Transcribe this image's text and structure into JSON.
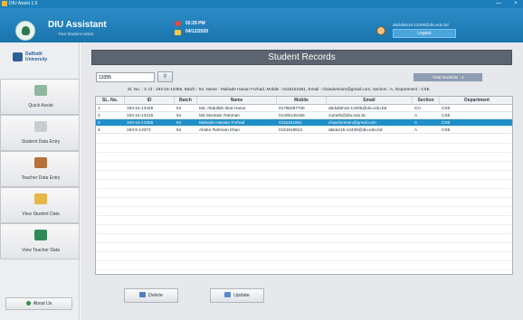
{
  "window": {
    "title": "DIU Assist 1.5",
    "minimize": "—",
    "close": "×"
  },
  "header": {
    "app_name": "DIU Assistant",
    "app_subtitle": "Your Student Assist",
    "time": "02:29 PM",
    "date": "04/12/2020",
    "user_email": "abdullah15-13406@diu.edu.bd",
    "logout_label": "Logout"
  },
  "sidebar": {
    "brand": "Daffodil University",
    "items": [
      {
        "label": "Quick Assist",
        "icon": "book-icon"
      },
      {
        "label": "Student Data Entry",
        "icon": "student-icon"
      },
      {
        "label": "Teacher Data Entry",
        "icon": "teacher-icon"
      },
      {
        "label": "View Student Data",
        "icon": "view-student-icon"
      },
      {
        "label": "View Teacher Data",
        "icon": "view-teacher-icon"
      }
    ],
    "about_label": "About Us"
  },
  "main": {
    "banner": "Student Records",
    "search_value": "13355",
    "total_label": "Total Students : 4",
    "info": "Sl. No. : 3, Id : 193-15-13355, Batch : 54, Name : Mahade Hasan Forhad, Mobile : 0115161651, Email : chandumiam@gmail.com, Section : A, Department : CSE",
    "columns": [
      "SL. No.",
      "ID",
      "Batch",
      "Name",
      "Mobile",
      "Email",
      "Section",
      "Department"
    ],
    "rows": [
      [
        "1",
        "193-15-13425",
        "54",
        "Md. Abdullah Ibna Harun",
        "01786287706",
        "abdullah15-13406@diu.edu.bd",
        "CH",
        "CSE"
      ],
      [
        "2",
        "193-15-13415",
        "54",
        "Md Montasir Rahman",
        "01405145165",
        "zumefs@diu.edu.bc",
        "A",
        "CSE"
      ],
      [
        "3",
        "193-15-13355",
        "54",
        "Mahade Hassan Forhad",
        "0115161651",
        "chandumiam@gmail.com",
        "A",
        "CSE"
      ],
      [
        "4",
        "193-5-13373",
        "54",
        "Abidur Rahman Khan",
        "0151818812",
        "abidur15-13438@diu.edu.bd",
        "A",
        "CSE"
      ]
    ],
    "selected_row": 2,
    "delete_label": "Delete",
    "update_label": "Update"
  },
  "colors": {
    "accent": "#1d7fb9",
    "selected": "#1f8fc8",
    "banner": "#5c6470"
  }
}
